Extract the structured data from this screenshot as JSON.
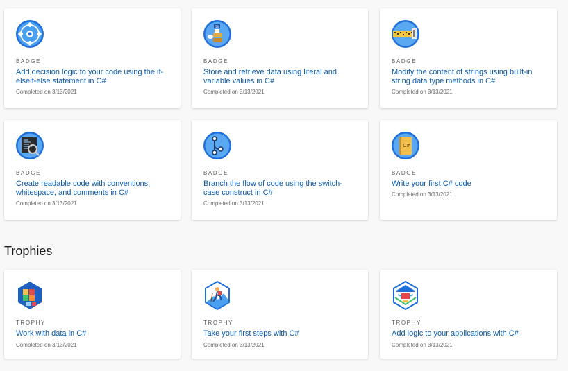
{
  "badges": [
    {
      "kind": "BADGE",
      "title": "Add decision logic to your code using the if-elseif-else statement in C#",
      "date": "Completed on 3/13/2021",
      "icon": "decision-logic-icon"
    },
    {
      "kind": "BADGE",
      "title": "Store and retrieve data using literal and variable values in C#",
      "date": "Completed on 3/13/2021",
      "icon": "data-storage-icon"
    },
    {
      "kind": "BADGE",
      "title": "Modify the content of strings using built-in string data type methods in C#",
      "date": "Completed on 3/13/2021",
      "icon": "string-methods-icon"
    },
    {
      "kind": "BADGE",
      "title": "Create readable code with conventions, whitespace, and comments in C#",
      "date": "Completed on 3/13/2021",
      "icon": "readable-code-icon"
    },
    {
      "kind": "BADGE",
      "title": "Branch the flow of code using the switch-case construct in C#",
      "date": "Completed on 3/13/2021",
      "icon": "branch-flow-icon"
    },
    {
      "kind": "BADGE",
      "title": "Write your first C# code",
      "date": "Completed on 3/13/2021",
      "icon": "csharp-book-icon"
    }
  ],
  "trophies_heading": "Trophies",
  "trophies": [
    {
      "kind": "TROPHY",
      "title": "Work with data in C#",
      "date": "Completed on 3/13/2021",
      "icon": "data-blocks-trophy-icon"
    },
    {
      "kind": "TROPHY",
      "title": "Take your first steps with C#",
      "date": "Completed on 3/13/2021",
      "icon": "hiker-trophy-icon"
    },
    {
      "kind": "TROPHY",
      "title": "Add logic to your applications with C#",
      "date": "Completed on 3/13/2021",
      "icon": "logic-trophy-icon"
    }
  ]
}
